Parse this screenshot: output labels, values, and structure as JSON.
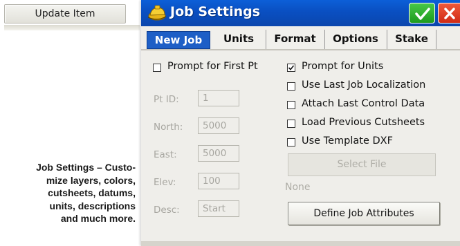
{
  "background": {
    "update_item_label": "Update Item",
    "caption_lines": [
      "Job Settings – Custo-",
      "mize layers, colors,",
      "cutsheets, datums,",
      "units, descriptions",
      "and much more."
    ]
  },
  "dialog": {
    "title": "Job Settings",
    "ok_icon": "checkmark-icon",
    "close_icon": "close-icon",
    "accent_color": "#0a4fc1",
    "ok_color": "#2aa82a",
    "close_color": "#e0391f",
    "tabs": [
      {
        "label": "New Job",
        "active": true
      },
      {
        "label": "Units",
        "active": false
      },
      {
        "label": "Format",
        "active": false
      },
      {
        "label": "Options",
        "active": false
      },
      {
        "label": "Stake",
        "active": false
      }
    ],
    "prompt_first_pt": {
      "label": "Prompt for First Pt",
      "checked": false
    },
    "fields": [
      {
        "label": "Pt ID:",
        "value": "1"
      },
      {
        "label": "North:",
        "value": "5000"
      },
      {
        "label": "East:",
        "value": "5000"
      },
      {
        "label": "Elev:",
        "value": "100"
      },
      {
        "label": "Desc:",
        "value": "Start"
      }
    ],
    "options": [
      {
        "label": "Prompt for Units",
        "checked": true
      },
      {
        "label": "Use Last Job Localization",
        "checked": false
      },
      {
        "label": "Attach Last Control Data",
        "checked": false
      },
      {
        "label": "Load Previous Cutsheets",
        "checked": false
      },
      {
        "label": "Use Template DXF",
        "checked": false
      }
    ],
    "select_file_label": "Select File",
    "file_status": "None",
    "define_attributes_label": "Define Job Attributes"
  }
}
